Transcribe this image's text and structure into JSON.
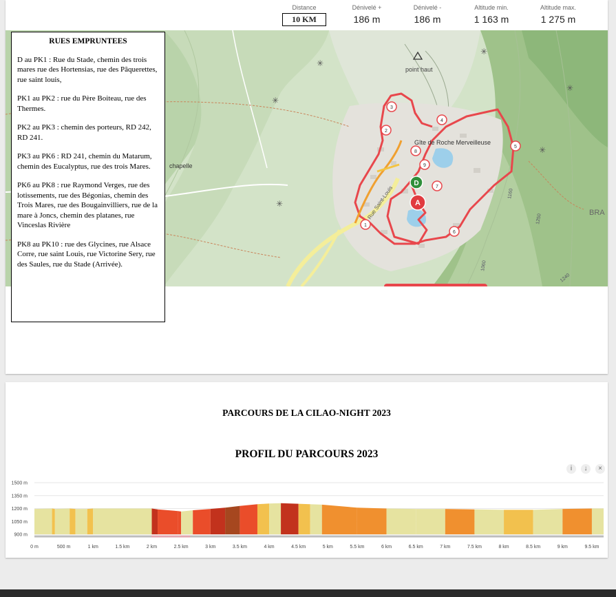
{
  "stats": [
    {
      "label": "Distance",
      "value": "10 KM"
    },
    {
      "label": "Dénivelé +",
      "value": "186 m"
    },
    {
      "label": "Dénivelé -",
      "value": "186 m"
    },
    {
      "label": "Altitude min.",
      "value": "1 163 m"
    },
    {
      "label": "Altitude max.",
      "value": "1 275 m"
    }
  ],
  "map": {
    "poi_peak": "point haut",
    "poi_gite": "Gîte de Roche Merveilleuse",
    "poi_chapelle": "chapelle",
    "street": "Rue Saint-Louis",
    "area_label": "BRA",
    "start_marker": "D",
    "end_marker": "A",
    "contours": [
      "1160",
      "1250",
      "1060",
      "1240"
    ],
    "checkpoints": [
      "1",
      "2",
      "3",
      "4",
      "5",
      "6",
      "7",
      "8",
      "9"
    ],
    "route_color": "#e8474c",
    "map_bg": "#cfe0c5"
  },
  "roads": {
    "title": "RUES EMPRUNTEES",
    "items": [
      "D au PK1 : Rue du Stade, chemin des trois mares rue des Hortensias, rue des Pâquerettes, rue saint louis,",
      "PK1 au PK2 : rue du Père Boiteau, rue des Thermes.",
      "PK2 au PK3 : chemin des porteurs, RD 242, RD 241.",
      "PK3 au PK6 : RD 241, chemin du Matarum, chemin des Eucalyptus, rue des trois Mares.",
      "PK6 au PK8 : rue Raymond Verges, rue des lotissements, rue des Bégonias, chemin des Trois Mares, rue des Bougainvilliers, rue de la mare à Joncs, chemin des platanes, rue Vinceslas Rivière",
      "PK8 au PK10 : rue des Glycines, rue Alsace Corre, rue saint Louis, rue Victorine Sery, rue des Saules, rue du Stade (Arrivée)."
    ]
  },
  "page2": {
    "title1": "PARCOURS DE LA CILAO-NIGHT 2023",
    "title2": "PROFIL DU PARCOURS 2023",
    "controls": [
      {
        "icon": "info-icon",
        "glyph": "i"
      },
      {
        "icon": "download-icon",
        "glyph": "↓"
      },
      {
        "icon": "close-icon",
        "glyph": "×"
      }
    ]
  },
  "chart_data": {
    "type": "area",
    "title": "",
    "xlabel": "",
    "ylabel": "",
    "y_ticks": [
      "1500 m",
      "1350 m",
      "1200 m",
      "1050 m",
      "900 m"
    ],
    "x_ticks": [
      "0 m",
      "500 m",
      "1 km",
      "1.5 km",
      "2 km",
      "2.5 km",
      "3 km",
      "3.5 km",
      "4 km",
      "4.5 km",
      "5 km",
      "5.5 km",
      "6 km",
      "6.5 km",
      "7 km",
      "7.5 km",
      "8 km",
      "8.5 km",
      "9 km",
      "9.5 km"
    ],
    "ylim": [
      900,
      1500
    ],
    "xlim": [
      0,
      9.7
    ],
    "x": [
      0,
      0.3,
      0.35,
      0.6,
      0.7,
      0.9,
      1.0,
      2.0,
      2.1,
      2.45,
      2.5,
      2.7,
      3.0,
      3.25,
      3.5,
      3.8,
      4.0,
      4.2,
      4.5,
      4.7,
      4.9,
      5.5,
      6.0,
      6.5,
      7.0,
      7.5,
      8.0,
      8.5,
      9.0,
      9.5,
      9.7
    ],
    "y": [
      1195,
      1200,
      1195,
      1200,
      1195,
      1195,
      1200,
      1200,
      1190,
      1170,
      1165,
      1180,
      1195,
      1210,
      1230,
      1250,
      1258,
      1262,
      1255,
      1250,
      1245,
      1210,
      1200,
      1195,
      1195,
      1190,
      1185,
      1185,
      1195,
      1200,
      1200
    ],
    "segment_colors": [
      "#e6e3a0",
      "#f2c14e",
      "#f0902f",
      "#ea4d2a",
      "#c2321d",
      "#a6471f"
    ],
    "highlight_range_km": [
      2.0,
      2.65
    ]
  }
}
